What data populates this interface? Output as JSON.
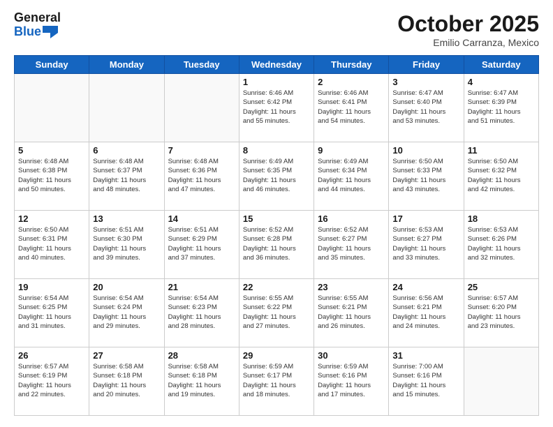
{
  "logo": {
    "line1": "General",
    "line2": "Blue"
  },
  "header": {
    "title": "October 2025",
    "subtitle": "Emilio Carranza, Mexico"
  },
  "weekdays": [
    "Sunday",
    "Monday",
    "Tuesday",
    "Wednesday",
    "Thursday",
    "Friday",
    "Saturday"
  ],
  "weeks": [
    [
      {
        "day": "",
        "info": ""
      },
      {
        "day": "",
        "info": ""
      },
      {
        "day": "",
        "info": ""
      },
      {
        "day": "1",
        "info": "Sunrise: 6:46 AM\nSunset: 6:42 PM\nDaylight: 11 hours\nand 55 minutes."
      },
      {
        "day": "2",
        "info": "Sunrise: 6:46 AM\nSunset: 6:41 PM\nDaylight: 11 hours\nand 54 minutes."
      },
      {
        "day": "3",
        "info": "Sunrise: 6:47 AM\nSunset: 6:40 PM\nDaylight: 11 hours\nand 53 minutes."
      },
      {
        "day": "4",
        "info": "Sunrise: 6:47 AM\nSunset: 6:39 PM\nDaylight: 11 hours\nand 51 minutes."
      }
    ],
    [
      {
        "day": "5",
        "info": "Sunrise: 6:48 AM\nSunset: 6:38 PM\nDaylight: 11 hours\nand 50 minutes."
      },
      {
        "day": "6",
        "info": "Sunrise: 6:48 AM\nSunset: 6:37 PM\nDaylight: 11 hours\nand 48 minutes."
      },
      {
        "day": "7",
        "info": "Sunrise: 6:48 AM\nSunset: 6:36 PM\nDaylight: 11 hours\nand 47 minutes."
      },
      {
        "day": "8",
        "info": "Sunrise: 6:49 AM\nSunset: 6:35 PM\nDaylight: 11 hours\nand 46 minutes."
      },
      {
        "day": "9",
        "info": "Sunrise: 6:49 AM\nSunset: 6:34 PM\nDaylight: 11 hours\nand 44 minutes."
      },
      {
        "day": "10",
        "info": "Sunrise: 6:50 AM\nSunset: 6:33 PM\nDaylight: 11 hours\nand 43 minutes."
      },
      {
        "day": "11",
        "info": "Sunrise: 6:50 AM\nSunset: 6:32 PM\nDaylight: 11 hours\nand 42 minutes."
      }
    ],
    [
      {
        "day": "12",
        "info": "Sunrise: 6:50 AM\nSunset: 6:31 PM\nDaylight: 11 hours\nand 40 minutes."
      },
      {
        "day": "13",
        "info": "Sunrise: 6:51 AM\nSunset: 6:30 PM\nDaylight: 11 hours\nand 39 minutes."
      },
      {
        "day": "14",
        "info": "Sunrise: 6:51 AM\nSunset: 6:29 PM\nDaylight: 11 hours\nand 37 minutes."
      },
      {
        "day": "15",
        "info": "Sunrise: 6:52 AM\nSunset: 6:28 PM\nDaylight: 11 hours\nand 36 minutes."
      },
      {
        "day": "16",
        "info": "Sunrise: 6:52 AM\nSunset: 6:27 PM\nDaylight: 11 hours\nand 35 minutes."
      },
      {
        "day": "17",
        "info": "Sunrise: 6:53 AM\nSunset: 6:27 PM\nDaylight: 11 hours\nand 33 minutes."
      },
      {
        "day": "18",
        "info": "Sunrise: 6:53 AM\nSunset: 6:26 PM\nDaylight: 11 hours\nand 32 minutes."
      }
    ],
    [
      {
        "day": "19",
        "info": "Sunrise: 6:54 AM\nSunset: 6:25 PM\nDaylight: 11 hours\nand 31 minutes."
      },
      {
        "day": "20",
        "info": "Sunrise: 6:54 AM\nSunset: 6:24 PM\nDaylight: 11 hours\nand 29 minutes."
      },
      {
        "day": "21",
        "info": "Sunrise: 6:54 AM\nSunset: 6:23 PM\nDaylight: 11 hours\nand 28 minutes."
      },
      {
        "day": "22",
        "info": "Sunrise: 6:55 AM\nSunset: 6:22 PM\nDaylight: 11 hours\nand 27 minutes."
      },
      {
        "day": "23",
        "info": "Sunrise: 6:55 AM\nSunset: 6:21 PM\nDaylight: 11 hours\nand 26 minutes."
      },
      {
        "day": "24",
        "info": "Sunrise: 6:56 AM\nSunset: 6:21 PM\nDaylight: 11 hours\nand 24 minutes."
      },
      {
        "day": "25",
        "info": "Sunrise: 6:57 AM\nSunset: 6:20 PM\nDaylight: 11 hours\nand 23 minutes."
      }
    ],
    [
      {
        "day": "26",
        "info": "Sunrise: 6:57 AM\nSunset: 6:19 PM\nDaylight: 11 hours\nand 22 minutes."
      },
      {
        "day": "27",
        "info": "Sunrise: 6:58 AM\nSunset: 6:18 PM\nDaylight: 11 hours\nand 20 minutes."
      },
      {
        "day": "28",
        "info": "Sunrise: 6:58 AM\nSunset: 6:18 PM\nDaylight: 11 hours\nand 19 minutes."
      },
      {
        "day": "29",
        "info": "Sunrise: 6:59 AM\nSunset: 6:17 PM\nDaylight: 11 hours\nand 18 minutes."
      },
      {
        "day": "30",
        "info": "Sunrise: 6:59 AM\nSunset: 6:16 PM\nDaylight: 11 hours\nand 17 minutes."
      },
      {
        "day": "31",
        "info": "Sunrise: 7:00 AM\nSunset: 6:16 PM\nDaylight: 11 hours\nand 15 minutes."
      },
      {
        "day": "",
        "info": ""
      }
    ]
  ]
}
